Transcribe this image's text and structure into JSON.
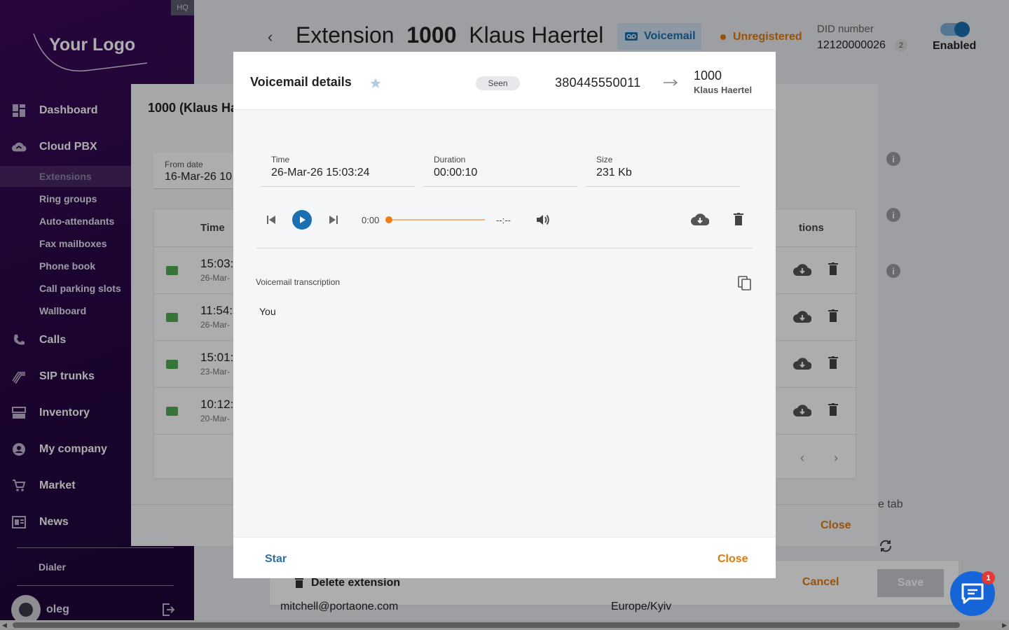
{
  "sidebar": {
    "hq_badge": "HQ",
    "logo_text": "Your Logo",
    "nav": [
      {
        "label": "Dashboard",
        "icon": "dashboard-icon"
      },
      {
        "label": "Cloud PBX",
        "icon": "cloud-icon"
      },
      {
        "label": "Calls",
        "icon": "phone-icon"
      },
      {
        "label": "SIP trunks",
        "icon": "sip-trunk-icon"
      },
      {
        "label": "Inventory",
        "icon": "inventory-icon"
      },
      {
        "label": "My company",
        "icon": "company-icon"
      },
      {
        "label": "Market",
        "icon": "cart-icon"
      },
      {
        "label": "News",
        "icon": "news-icon"
      }
    ],
    "sub_items": [
      "Extensions",
      "Ring groups",
      "Auto-attendants",
      "Fax mailboxes",
      "Phone book",
      "Call parking slots",
      "Wallboard"
    ],
    "active_sub": "Extensions",
    "dialer": "Dialer",
    "user": "oleg"
  },
  "header": {
    "title_prefix": "Extension",
    "ext_number": "1000",
    "ext_name": "Klaus Haertel",
    "voicemail_chip": "Voicemail",
    "status": "Unregistered",
    "status_color": "#e07a10",
    "did_label": "DID number",
    "did_value": "12120000026",
    "did_count": "2",
    "enabled_label": "Enabled"
  },
  "mid_dialog": {
    "title": "1000 (Klaus Ha",
    "from_date_label": "From date",
    "from_date_value": "16-Mar-26 10",
    "col_time": "Time",
    "col_actions": "tions",
    "rows": [
      {
        "time": "15:03:",
        "date": "26-Mar-"
      },
      {
        "time": "11:54:",
        "date": "26-Mar-"
      },
      {
        "time": "15:01:",
        "date": "23-Mar-"
      },
      {
        "time": "10:12:",
        "date": "20-Mar-"
      }
    ],
    "pager_prev": "‹",
    "pager_next": "›",
    "close": "Close"
  },
  "page_bottom": {
    "tab_text": "e tab",
    "delete_extension": "Delete extension",
    "email": "mitchell@portaone.com",
    "timezone": "Europe/Kyiv",
    "cancel": "Cancel",
    "save": "Save"
  },
  "dialog": {
    "title": "Voicemail details",
    "seen": "Seen",
    "caller": "380445550011",
    "callee_number": "1000",
    "callee_name": "Klaus Haertel",
    "time_label": "Time",
    "time_value": "26-Mar-26 15:03:24",
    "duration_label": "Duration",
    "duration_value": "00:00:10",
    "size_label": "Size",
    "size_value": "231 Kb",
    "player_current": "0:00",
    "player_end": "--:--",
    "player_progress": 0,
    "transcription_label": "Voicemail transcription",
    "transcription_text": "You",
    "star_button": "Star",
    "close_button": "Close"
  },
  "chat": {
    "badge": "1"
  },
  "colors": {
    "accent_orange": "#e07a10",
    "primary_blue": "#1a6fb0",
    "sidebar_purple": "#2a0848"
  }
}
